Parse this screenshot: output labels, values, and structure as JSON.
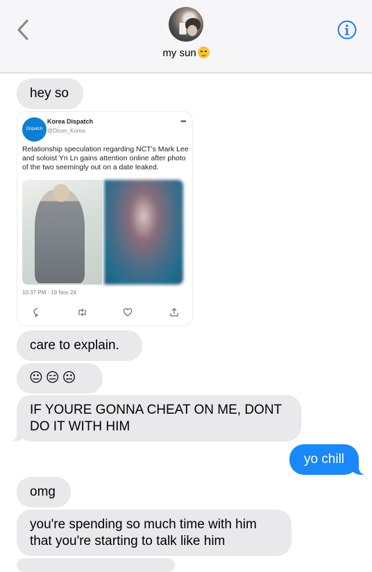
{
  "header": {
    "contact_name": "my sun",
    "avatar_icon": "contact-photo"
  },
  "messages": [
    {
      "dir": "in",
      "text": "hey so"
    },
    {
      "dir": "in",
      "type": "tweet",
      "tweet": {
        "avatar_text": "Dispatch",
        "name": "Korea Dispatch",
        "handle": "@Dicon_Korea",
        "more": "•••",
        "text": "Relationship speculation regarding NCT's Mark Lee and soloist Yn Ln gains attention online after photo of the two seemingly out on a date leaked.",
        "time": "10:37 PM · 19 Nov 24"
      }
    },
    {
      "dir": "in",
      "text": "care to explain."
    },
    {
      "dir": "in",
      "text": "😐😑😐"
    },
    {
      "dir": "in",
      "text": "IF YOURE GONNA CHEAT ON ME, DONT DO IT WITH HIM"
    },
    {
      "dir": "out",
      "text": "yo chill"
    },
    {
      "dir": "in",
      "text": "omg"
    },
    {
      "dir": "in",
      "text": "you're spending so much time with him that you're starting to talk like him"
    }
  ],
  "colors": {
    "incoming_bubble": "#e9e9eb",
    "outgoing_bubble": "#1a88f8",
    "ios_blue": "#1a7cf4"
  }
}
